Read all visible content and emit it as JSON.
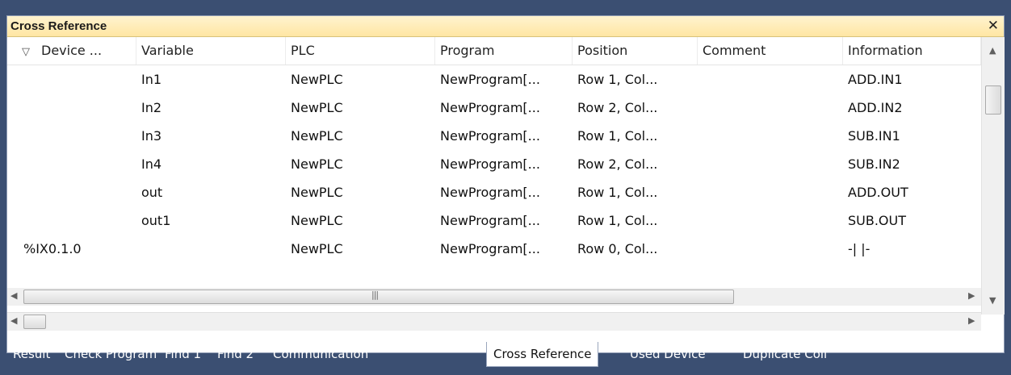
{
  "panel": {
    "title": "Cross Reference",
    "close_glyph": "✕"
  },
  "columns": [
    "Device ...",
    "Variable",
    "PLC",
    "Program",
    "Position",
    "Comment",
    "Information"
  ],
  "rows": [
    [
      "",
      "In1",
      "NewPLC",
      "NewProgram[...",
      "Row 1, Col...",
      "",
      "ADD.IN1"
    ],
    [
      "",
      "In2",
      "NewPLC",
      "NewProgram[...",
      "Row 2, Col...",
      "",
      "ADD.IN2"
    ],
    [
      "",
      "In3",
      "NewPLC",
      "NewProgram[...",
      "Row 1, Col...",
      "",
      "SUB.IN1"
    ],
    [
      "",
      "In4",
      "NewPLC",
      "NewProgram[...",
      "Row 2, Col...",
      "",
      "SUB.IN2"
    ],
    [
      "",
      "out",
      "NewPLC",
      "NewProgram[...",
      "Row 1, Col...",
      "",
      "ADD.OUT"
    ],
    [
      "",
      "out1",
      "NewPLC",
      "NewProgram[...",
      "Row 1, Col...",
      "",
      "SUB.OUT"
    ],
    [
      "%IX0.1.0",
      "",
      "NewPLC",
      "NewProgram[...",
      "Row 0, Col...",
      "",
      "-| |-"
    ]
  ],
  "tabs": [
    {
      "label": "Result",
      "active": false
    },
    {
      "label": "Check Program",
      "active": false
    },
    {
      "label": "Find 1",
      "active": false
    },
    {
      "label": "Find 2",
      "active": false
    },
    {
      "label": "Communication",
      "active": false
    },
    {
      "label": "Cross Reference",
      "active": true
    },
    {
      "label": "Used Device",
      "active": false
    },
    {
      "label": "Duplicate Coil",
      "active": false
    }
  ],
  "icons": {
    "sort": "sort-filter-icon",
    "close": "close-icon",
    "scroll_up": "scroll-up-arrow-icon",
    "scroll_down": "scroll-down-arrow-icon",
    "scroll_left": "scroll-left-arrow-icon",
    "scroll_right": "scroll-right-arrow-icon"
  },
  "colors": {
    "title_bg": "#ffe6a3",
    "tabbar_bg": "#3b4f72",
    "active_tab_bg": "#ffffff"
  }
}
